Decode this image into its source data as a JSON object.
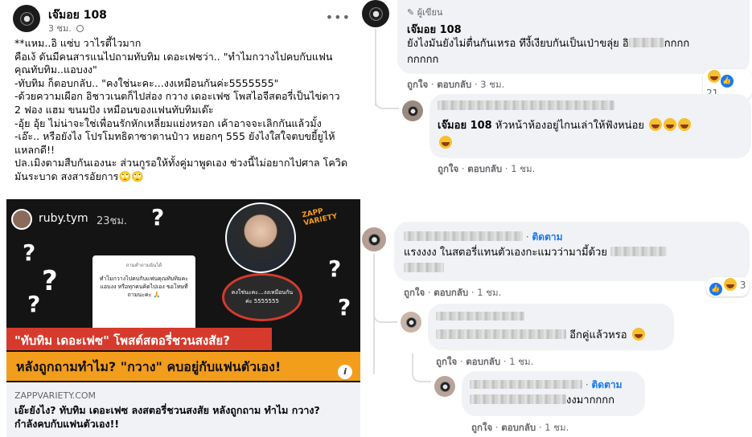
{
  "post": {
    "author": "เจ๊มอย 108",
    "time": "3 ชม.",
    "text": "**แหม..อิ แซ่บ วาไรตี้ไวมาก\nคือเง้ ดันมีคนสารแนไปถามทับทิม เดอะเฟซว่า.. \"ทำไมกวางไปคบกับแฟน\nคุณทับทิม..แอบงง\"\n-ทับทิม ก็ตอบกลับ.. \"คงใช่นะคะ...งงเหมือนกันค่ะ5555555\"\n-ด้วยความเผือก อิชาวเนตก็ไปส่อง กวาง เดอะเฟซ โพสไอจีสตอรี่เป็นไข่ดาว\n2 ฟอง แฮม ขนมปัง เหมือนของแฟนทับทิมเด๊ะ\n-อุ้ย อุ้ย ไม่น่าจะใช่เพื่อนรักหักเหลี่ยมแย่งหรอก เค้าอาจจะเลิกกันแล้วมั้ง\n-เอ๊ะ.. หรือยังไง โปรโมทธิดาซาตานป๋าว หยอกๆ 555 ยังไงใสใจตบขยี้ยูไห้\nแหลกดี!!\nปล.เมิงตามสืบกันเองนะ ส่วนกูรอให้ทั้งคู่มาพูดเอง ช่วงนี้ไม่อยากไปศาล โควิด\nมันระบาด สงสารอัยการ🙄🙄"
  },
  "image": {
    "story_user": "ruby.tym",
    "story_time": "23ชม.",
    "brand": "ZAPP VARIETY",
    "story_card_text": "ทำไมกวางไปคบกับแฟนคุณทับทิมคะ แอบงง หรือทุกคนคิดไปเอง ขอโทษที่ถามนะคะ 🙏",
    "reply_bubble_text": "คงใช่นะคะ...งงเหมือนกันค่ะ 5555555",
    "banner_red": "\"ทับทิม เดอะเฟซ\" โพสต์สตอรี่ชวนสงสัย?",
    "banner_orange": "หลังถูกถามทำไม? \"กวาง\" คบอยู่กับแฟนตัวเอง!"
  },
  "link": {
    "domain": "ZAPPVARIETY.COM",
    "title": "เอ๊ะยังไง? ทับทิม เดอะเฟซ ลงสตอรี่ชวนสงสัย หลังถูกถาม ทำไม กวาง? กำลังคบกับแฟนตัวเอง!!"
  },
  "comments": [
    {
      "badge": "ผู้เขียน",
      "author": "เจ๊มอย 108",
      "text_line1": "ยังไงมันยังไม่ตื่นกันเหรอ ทีงี้เงียบกันเป็นเป่าขลุ่ย อิ",
      "text_tail": "กกกก",
      "text_line2": "กกกกก",
      "like": "ถูกใจ",
      "reply": "ตอบกลับ",
      "time": "3 ชม.",
      "reaction_count": "21"
    },
    {
      "author": "เจ๊มอย 108",
      "text_line1": "หัวหน้าห้องอยู่ไกนเล่าให้ฟังหน่อย",
      "like": "ถูกใจ",
      "reply": "ตอบกลับ",
      "time": "1 ชม."
    },
    {
      "follow": "ติดตาม",
      "text_line1": "แรงงงง ในสตอรี่แทนตัวเองกะแมวว่ามามี้ด้วย",
      "like": "ถูกใจ",
      "reply": "ตอบกลับ",
      "time": "1 ชม.",
      "reaction_count": "3"
    },
    {
      "text_line1": "อีกคู่แล้วหรอ",
      "like": "ถูกใจ",
      "reply": "ตอบกลับ",
      "time": "1 ชม."
    },
    {
      "follow": "ติดตาม",
      "text_line1": "งงมากกกก",
      "like": "ถูกใจ",
      "reply": "ตอบกลับ",
      "time": "1 ชม."
    }
  ],
  "colors": {
    "link_blue": "#1877f2",
    "bubble_bg": "#f0f2f5",
    "meta_gray": "#65676b",
    "banner_red": "#d63a2c",
    "banner_orange": "#f39d1d"
  }
}
